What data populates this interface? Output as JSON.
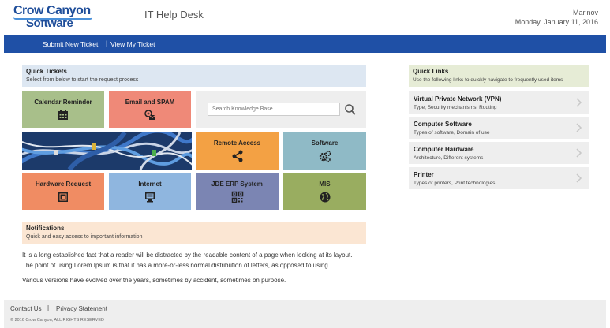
{
  "header": {
    "logo_line1": "Crow Canyon",
    "logo_line2": "Software",
    "app_title": "IT Help Desk",
    "user_name": "Marinov",
    "date": "Monday, January 11, 2016"
  },
  "nav": {
    "submit": "Submit New Ticket",
    "separator": "|",
    "view": "View My Ticket"
  },
  "quick_tickets": {
    "title": "Quick Tickets",
    "subtitle": "Select from below to start the request process",
    "tiles": [
      {
        "label": "Calendar Reminder",
        "icon": "calendar-icon",
        "color": "#a8bf8a"
      },
      {
        "label": "Email and SPAM",
        "icon": "email-icon",
        "color": "#ef8978"
      },
      {
        "label": "Remote Access",
        "icon": "share-icon",
        "color": "#f3a144"
      },
      {
        "label": "Software",
        "icon": "gears-icon",
        "color": "#8fbac6"
      },
      {
        "label": "Hardware Request",
        "icon": "hardware-icon",
        "color": "#f08c63"
      },
      {
        "label": "Internet",
        "icon": "monitor-icon",
        "color": "#8fb6df"
      },
      {
        "label": "JDE ERP System",
        "icon": "qr-code-icon",
        "color": "#7b85b3"
      },
      {
        "label": "MIS",
        "icon": "globe-icon",
        "color": "#99ad60"
      }
    ]
  },
  "search": {
    "placeholder": "Search Knowledge Base",
    "icon": "search-icon"
  },
  "notifications": {
    "title": "Notifications",
    "subtitle": "Quick and easy access to important information"
  },
  "body": {
    "p1_line1": "It is a long established fact that a reader will be distracted by the readable content of a page when looking at its layout.",
    "p1_line2": "The point of using Lorem Ipsum is that it has a more-or-less normal distribution of letters, as opposed to using.",
    "p2": "Various versions have evolved over the years, sometimes by accident, sometimes on purpose."
  },
  "quick_links": {
    "title": "Quick Links",
    "subtitle": "Use the following links to quickly navigate to frequently used items",
    "items": [
      {
        "title": "Virtual Private Network (VPN)",
        "sub": "Type, Security mechanisms, Routing"
      },
      {
        "title": "Computer Software",
        "sub": "Types of software, Domain of use"
      },
      {
        "title": "Computer Hardware",
        "sub": "Architecture, Different systems"
      },
      {
        "title": "Printer",
        "sub": "Types of printers, Print technologies"
      }
    ]
  },
  "footer": {
    "contact": "Contact Us",
    "separator": "|",
    "privacy": "Privacy Statement",
    "copyright": "© 2016 Crow Canyon, ALL RIGHTS RESERVED"
  },
  "colors": {
    "nav_bar": "#1f50a6",
    "quick_tickets_header": "#dde7f2",
    "notifications_header": "#fbe6d3",
    "quick_links_header": "#e6ecd6"
  }
}
